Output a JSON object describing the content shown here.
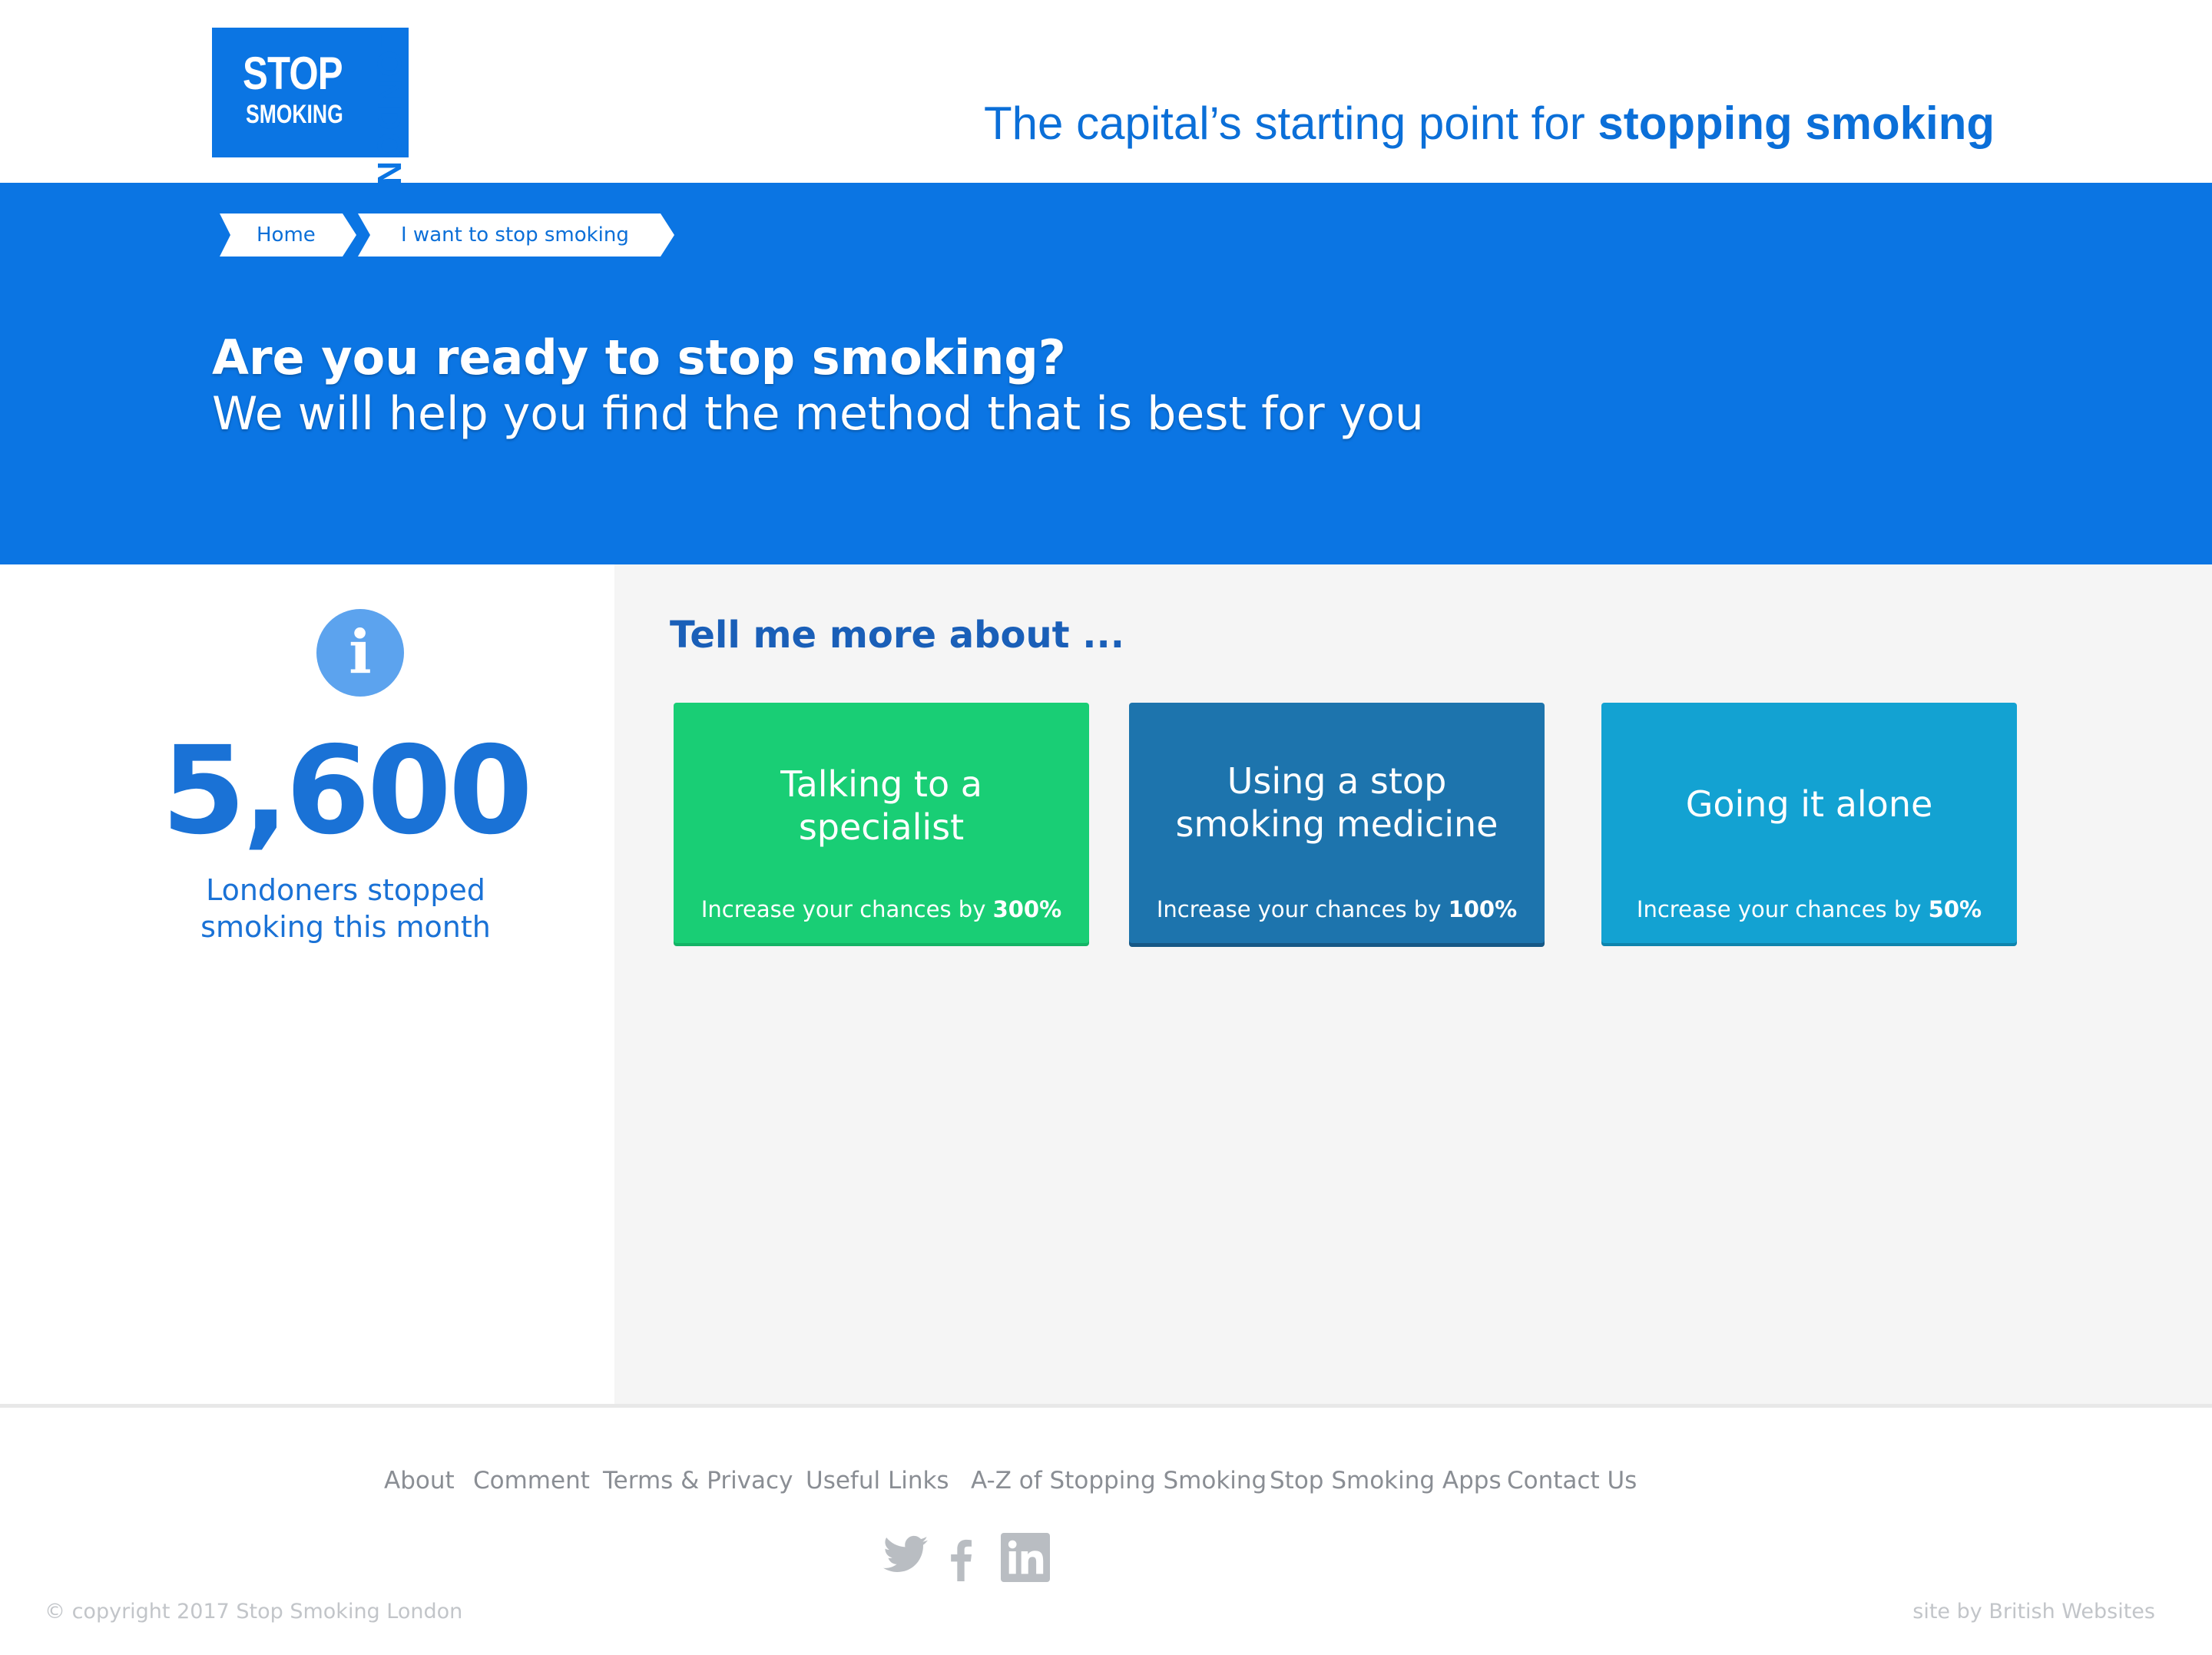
{
  "brand": {
    "logo_stop": "STOP",
    "logo_smoking": "SMOKING",
    "logo_london": "LONDON",
    "tagline_prefix": "The capital’s starting point for ",
    "tagline_bold": "stopping smoking",
    "primary_color": "#0b75e3"
  },
  "breadcrumb": {
    "items": [
      {
        "label": "Home"
      },
      {
        "label": "I want to stop smoking"
      }
    ]
  },
  "hero": {
    "title": "Are you ready to stop smoking?",
    "subtitle": "We will help you find the method that is best for you"
  },
  "stats": {
    "icon": "info-icon",
    "number": "5,600",
    "caption_line1": "Londoners stopped",
    "caption_line2": "smoking this month"
  },
  "options": {
    "heading": "Tell me more about ...",
    "cards": [
      {
        "title_line1": "Talking to a",
        "title_line2": "specialist",
        "chance_prefix": "Increase your chances by ",
        "chance_value": "300%",
        "color": "#19ce75"
      },
      {
        "title_line1": "Using a stop",
        "title_line2": "smoking medicine",
        "chance_prefix": "Increase your chances by ",
        "chance_value": "100%",
        "color": "#1d74ad"
      },
      {
        "title_line1": "Going it alone",
        "chance_prefix": "Increase your chances by ",
        "chance_value": "50%",
        "color": "#13a2d2"
      }
    ]
  },
  "footer": {
    "links": [
      "About",
      "Comment",
      "Terms & Privacy",
      "Useful Links",
      "A-Z of Stopping Smoking",
      "Stop Smoking Apps",
      "Contact Us"
    ],
    "social": [
      "twitter-icon",
      "facebook-icon",
      "linkedin-icon"
    ],
    "copyright": "© copyright 2017 Stop Smoking London",
    "credit": "site by British Websites"
  }
}
